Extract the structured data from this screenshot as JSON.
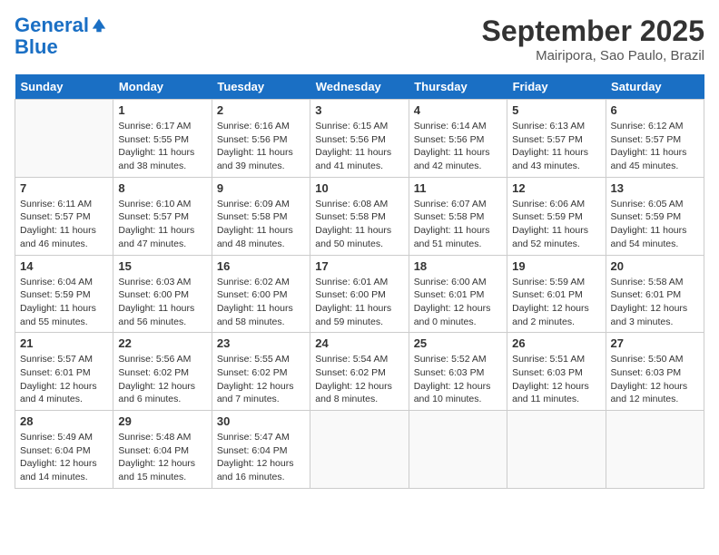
{
  "header": {
    "logo_line1": "General",
    "logo_line2": "Blue",
    "month_title": "September 2025",
    "location": "Mairipora, Sao Paulo, Brazil"
  },
  "days_of_week": [
    "Sunday",
    "Monday",
    "Tuesday",
    "Wednesday",
    "Thursday",
    "Friday",
    "Saturday"
  ],
  "weeks": [
    [
      {
        "day": "",
        "info": ""
      },
      {
        "day": "1",
        "info": "Sunrise: 6:17 AM\nSunset: 5:55 PM\nDaylight: 11 hours\nand 38 minutes."
      },
      {
        "day": "2",
        "info": "Sunrise: 6:16 AM\nSunset: 5:56 PM\nDaylight: 11 hours\nand 39 minutes."
      },
      {
        "day": "3",
        "info": "Sunrise: 6:15 AM\nSunset: 5:56 PM\nDaylight: 11 hours\nand 41 minutes."
      },
      {
        "day": "4",
        "info": "Sunrise: 6:14 AM\nSunset: 5:56 PM\nDaylight: 11 hours\nand 42 minutes."
      },
      {
        "day": "5",
        "info": "Sunrise: 6:13 AM\nSunset: 5:57 PM\nDaylight: 11 hours\nand 43 minutes."
      },
      {
        "day": "6",
        "info": "Sunrise: 6:12 AM\nSunset: 5:57 PM\nDaylight: 11 hours\nand 45 minutes."
      }
    ],
    [
      {
        "day": "7",
        "info": "Sunrise: 6:11 AM\nSunset: 5:57 PM\nDaylight: 11 hours\nand 46 minutes."
      },
      {
        "day": "8",
        "info": "Sunrise: 6:10 AM\nSunset: 5:57 PM\nDaylight: 11 hours\nand 47 minutes."
      },
      {
        "day": "9",
        "info": "Sunrise: 6:09 AM\nSunset: 5:58 PM\nDaylight: 11 hours\nand 48 minutes."
      },
      {
        "day": "10",
        "info": "Sunrise: 6:08 AM\nSunset: 5:58 PM\nDaylight: 11 hours\nand 50 minutes."
      },
      {
        "day": "11",
        "info": "Sunrise: 6:07 AM\nSunset: 5:58 PM\nDaylight: 11 hours\nand 51 minutes."
      },
      {
        "day": "12",
        "info": "Sunrise: 6:06 AM\nSunset: 5:59 PM\nDaylight: 11 hours\nand 52 minutes."
      },
      {
        "day": "13",
        "info": "Sunrise: 6:05 AM\nSunset: 5:59 PM\nDaylight: 11 hours\nand 54 minutes."
      }
    ],
    [
      {
        "day": "14",
        "info": "Sunrise: 6:04 AM\nSunset: 5:59 PM\nDaylight: 11 hours\nand 55 minutes."
      },
      {
        "day": "15",
        "info": "Sunrise: 6:03 AM\nSunset: 6:00 PM\nDaylight: 11 hours\nand 56 minutes."
      },
      {
        "day": "16",
        "info": "Sunrise: 6:02 AM\nSunset: 6:00 PM\nDaylight: 11 hours\nand 58 minutes."
      },
      {
        "day": "17",
        "info": "Sunrise: 6:01 AM\nSunset: 6:00 PM\nDaylight: 11 hours\nand 59 minutes."
      },
      {
        "day": "18",
        "info": "Sunrise: 6:00 AM\nSunset: 6:01 PM\nDaylight: 12 hours\nand 0 minutes."
      },
      {
        "day": "19",
        "info": "Sunrise: 5:59 AM\nSunset: 6:01 PM\nDaylight: 12 hours\nand 2 minutes."
      },
      {
        "day": "20",
        "info": "Sunrise: 5:58 AM\nSunset: 6:01 PM\nDaylight: 12 hours\nand 3 minutes."
      }
    ],
    [
      {
        "day": "21",
        "info": "Sunrise: 5:57 AM\nSunset: 6:01 PM\nDaylight: 12 hours\nand 4 minutes."
      },
      {
        "day": "22",
        "info": "Sunrise: 5:56 AM\nSunset: 6:02 PM\nDaylight: 12 hours\nand 6 minutes."
      },
      {
        "day": "23",
        "info": "Sunrise: 5:55 AM\nSunset: 6:02 PM\nDaylight: 12 hours\nand 7 minutes."
      },
      {
        "day": "24",
        "info": "Sunrise: 5:54 AM\nSunset: 6:02 PM\nDaylight: 12 hours\nand 8 minutes."
      },
      {
        "day": "25",
        "info": "Sunrise: 5:52 AM\nSunset: 6:03 PM\nDaylight: 12 hours\nand 10 minutes."
      },
      {
        "day": "26",
        "info": "Sunrise: 5:51 AM\nSunset: 6:03 PM\nDaylight: 12 hours\nand 11 minutes."
      },
      {
        "day": "27",
        "info": "Sunrise: 5:50 AM\nSunset: 6:03 PM\nDaylight: 12 hours\nand 12 minutes."
      }
    ],
    [
      {
        "day": "28",
        "info": "Sunrise: 5:49 AM\nSunset: 6:04 PM\nDaylight: 12 hours\nand 14 minutes."
      },
      {
        "day": "29",
        "info": "Sunrise: 5:48 AM\nSunset: 6:04 PM\nDaylight: 12 hours\nand 15 minutes."
      },
      {
        "day": "30",
        "info": "Sunrise: 5:47 AM\nSunset: 6:04 PM\nDaylight: 12 hours\nand 16 minutes."
      },
      {
        "day": "",
        "info": ""
      },
      {
        "day": "",
        "info": ""
      },
      {
        "day": "",
        "info": ""
      },
      {
        "day": "",
        "info": ""
      }
    ]
  ]
}
